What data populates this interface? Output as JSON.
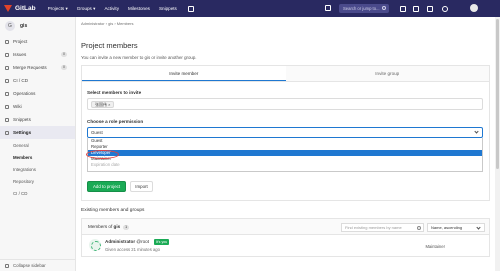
{
  "topbar": {
    "brand": "GitLab",
    "nav": [
      "Projects ▾",
      "Groups ▾",
      "Activity",
      "Milestones",
      "Snippets"
    ],
    "search_placeholder": "Search or jump to..."
  },
  "sidebar": {
    "project_initial": "G",
    "project_name": "gis",
    "items": [
      {
        "label": "Project"
      },
      {
        "label": "Issues",
        "count": "0"
      },
      {
        "label": "Merge Requests",
        "count": "0"
      },
      {
        "label": "CI / CD"
      },
      {
        "label": "Operations"
      },
      {
        "label": "Wiki"
      },
      {
        "label": "Snippets"
      },
      {
        "label": "Settings"
      }
    ],
    "subitems": [
      "General",
      "Members",
      "Integrations",
      "Repository",
      "CI / CD"
    ],
    "collapse_label": "Collapse sidebar"
  },
  "breadcrumb": "Administrator  ›  gis  ›  Members",
  "page": {
    "title": "Project members",
    "subtitle": "You can invite a new member to gis or invite another group.",
    "tabs": [
      "Invite member",
      "Invite group"
    ]
  },
  "invite": {
    "select_label": "Select members to invite",
    "token": "张国伟 ×",
    "role_label": "Choose a role permission",
    "role_value": "Guest",
    "options": [
      "Guest",
      "Reporter",
      "Developer",
      "Maintainer",
      "Expiration date"
    ],
    "add_button": "Add to project",
    "import_button": "Import"
  },
  "members": {
    "section_title": "Existing members and groups",
    "header_prefix": "Members of ",
    "header_project": "gis",
    "count": "1",
    "find_placeholder": "Find existing members by name",
    "sort_label": "Name, ascending",
    "rows": [
      {
        "name": "Administrator",
        "handle": "@root",
        "badge": "It's you",
        "access": "Given access 21 minutes ago",
        "role": "Maintainer"
      }
    ]
  },
  "colors": {
    "topbar": "#292961",
    "accent": "#1f78d1",
    "success": "#1aaa55"
  }
}
